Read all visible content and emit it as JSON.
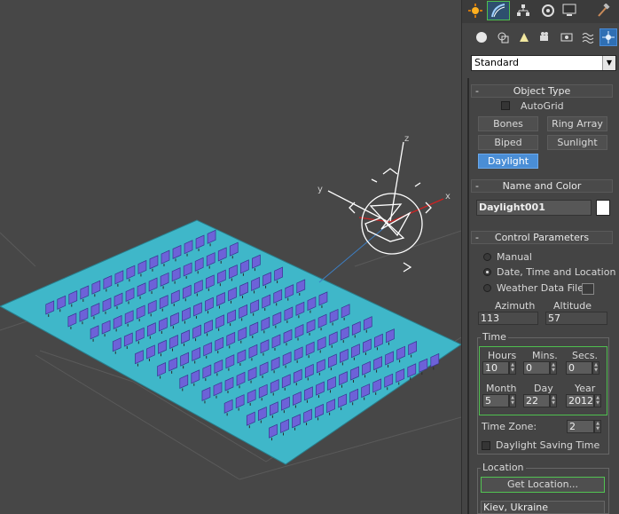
{
  "toolbar": {
    "tabs": [
      "create-icon",
      "modify-icon",
      "hierarchy-icon",
      "motion-icon",
      "display-icon",
      "utilities-icon"
    ],
    "categories": [
      "geometry-icon",
      "shapes-icon",
      "lights-icon",
      "cameras-icon",
      "helpers-icon",
      "space-warps-icon",
      "systems-icon"
    ]
  },
  "category_dropdown": {
    "value": "Standard"
  },
  "object_type": {
    "title": "Object Type",
    "autogrid_label": "AutoGrid",
    "buttons": [
      "Bones",
      "Ring Array",
      "Biped",
      "Sunlight",
      "Daylight"
    ]
  },
  "name_color": {
    "title": "Name and Color",
    "name_value": "Daylight001",
    "color": "#ffffff"
  },
  "control": {
    "title": "Control Parameters",
    "opt_manual": "Manual",
    "opt_date": "Date, Time and Location",
    "opt_weather": "Weather Data File",
    "azimuth_label": "Azimuth",
    "altitude_label": "Altitude",
    "azimuth_value": "113",
    "altitude_value": "57"
  },
  "time": {
    "title": "Time",
    "hours_label": "Hours",
    "mins_label": "Mins.",
    "secs_label": "Secs.",
    "hours": "10",
    "mins": "0",
    "secs": "0",
    "month_label": "Month",
    "day_label": "Day",
    "year_label": "Year",
    "month": "5",
    "day": "22",
    "year": "2012",
    "timezone_label": "Time Zone:",
    "timezone": "2",
    "dst_label": "Daylight Saving Time"
  },
  "location": {
    "title": "Location",
    "get_button": "Get Location...",
    "city": "Kiev, Ukraine"
  },
  "viewport": {
    "axis_x": "x",
    "axis_y": "y",
    "axis_z": "z",
    "ground_color": "#3fb7c9",
    "solar_panel_color": "#6d62d8"
  }
}
